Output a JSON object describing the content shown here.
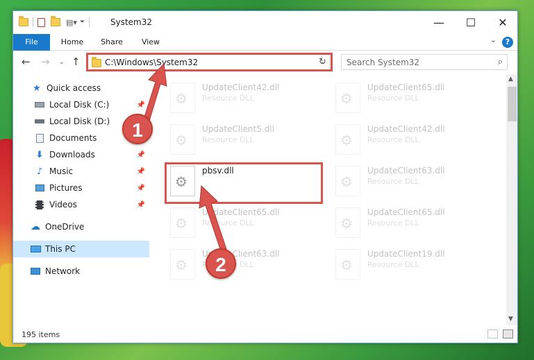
{
  "window": {
    "title": "System32",
    "minimize": "—",
    "maximize": "☐",
    "close": "✕"
  },
  "ribbon": {
    "tabs": [
      "File",
      "Home",
      "Share",
      "View"
    ],
    "help": "?"
  },
  "address": {
    "path": "C:\\Windows\\System32"
  },
  "search": {
    "placeholder": "Search System32"
  },
  "sidebar": {
    "quick_access": "Quick access",
    "items": [
      {
        "label": "Local Disk (C:)",
        "icon": "drive-icon"
      },
      {
        "label": "Local Disk (D:)",
        "icon": "drive-icon"
      },
      {
        "label": "Documents",
        "icon": "documents-icon"
      },
      {
        "label": "Downloads",
        "icon": "downloads-icon"
      },
      {
        "label": "Music",
        "icon": "music-icon"
      },
      {
        "label": "Pictures",
        "icon": "pictures-icon"
      },
      {
        "label": "Videos",
        "icon": "videos-icon"
      }
    ],
    "onedrive": "OneDrive",
    "this_pc": "This PC",
    "network": "Network"
  },
  "files": {
    "col1": [
      {
        "name": "UpdateClient42.dll",
        "type": "Resource DLL"
      },
      {
        "name": "UpdateClient5.dll",
        "type": "Resource DLL"
      },
      {
        "name": "pbsv.dll",
        "type": ""
      },
      {
        "name": "UpdateClient65.dll",
        "type": "Resource DLL"
      },
      {
        "name": "UpdateClient63.dll",
        "type": "Resource DLL"
      }
    ],
    "col2": [
      {
        "name": "UpdateClient65.dll",
        "type": "Resource DLL"
      },
      {
        "name": "UpdateClient42.dll",
        "type": "Resource DLL"
      },
      {
        "name": "UpdateClient63.dll",
        "type": "Resource DLL"
      },
      {
        "name": "UpdateClient65.dll",
        "type": "Resource DLL"
      },
      {
        "name": "UpdateClient19.dll",
        "type": "Resource DLL"
      }
    ]
  },
  "status": {
    "count": "195 items"
  },
  "callouts": {
    "one": "1",
    "two": "2"
  },
  "colors": {
    "accent": "#1979ca",
    "highlight": "#d9534f",
    "selected": "#cce8ff"
  }
}
